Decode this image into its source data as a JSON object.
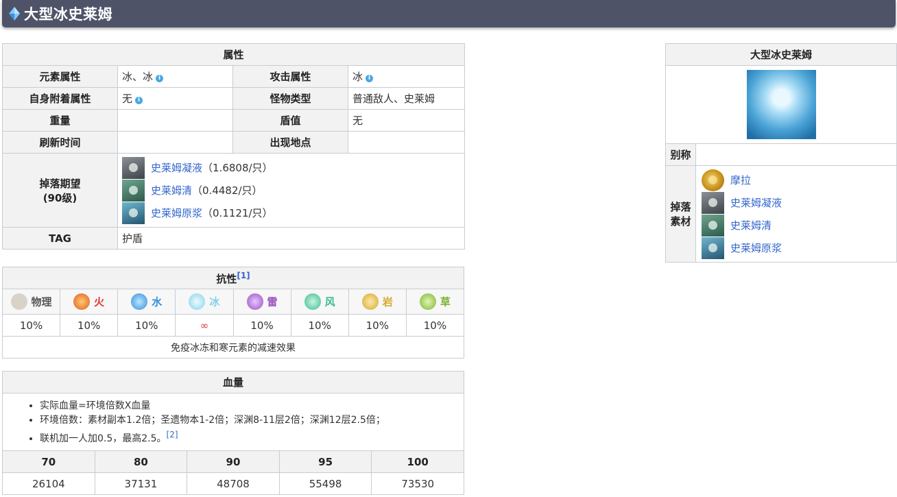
{
  "page": {
    "title": "大型冰史莱姆"
  },
  "attributes": {
    "header": "属性",
    "element_label": "元素属性",
    "element_value": "冰、冰",
    "attack_label": "攻击属性",
    "attack_value": "冰",
    "self_label": "自身附着属性",
    "self_value": "无",
    "type_label": "怪物类型",
    "type_value": "普通敌人、史莱姆",
    "weight_label": "重量",
    "weight_value": "",
    "shield_label": "盾值",
    "shield_value": "无",
    "refresh_label": "刷新时间",
    "refresh_value": "",
    "location_label": "出现地点",
    "location_value": "",
    "drop_label": "掉落期望",
    "drop_label2": "(90级)",
    "drops": [
      {
        "name": "史莱姆凝液",
        "rate": "（1.6808/只）",
        "icon": "slime-condensate-icon"
      },
      {
        "name": "史莱姆清",
        "rate": "（0.4482/只）",
        "icon": "slime-secretions-icon"
      },
      {
        "name": "史莱姆原浆",
        "rate": "（0.1121/只）",
        "icon": "slime-concentrate-icon"
      }
    ],
    "tag_label": "TAG",
    "tag_value": "护盾"
  },
  "resistance": {
    "header": "抗性",
    "ref": "[1]",
    "columns": [
      {
        "label": "物理",
        "value": "10%",
        "color": "#555555"
      },
      {
        "label": "火",
        "value": "10%",
        "color": "#e0332b"
      },
      {
        "label": "水",
        "value": "10%",
        "color": "#2e8fd8"
      },
      {
        "label": "冰",
        "value": "∞",
        "color": "#7fd3ec"
      },
      {
        "label": "雷",
        "value": "10%",
        "color": "#9a4fc0"
      },
      {
        "label": "风",
        "value": "10%",
        "color": "#3dbb8f"
      },
      {
        "label": "岩",
        "value": "10%",
        "color": "#d7a82d"
      },
      {
        "label": "草",
        "value": "10%",
        "color": "#7bb52e"
      }
    ],
    "note": "免疫冰冻和寒元素的减速效果"
  },
  "hp": {
    "header": "血量",
    "notes": [
      "实际血量=环境倍数X血量",
      "环境倍数：素材副本1.2倍；圣遗物本1-2倍；深渊8-11层2倍；深渊12层2.5倍；",
      "联机加一人加0.5，最高2.5。"
    ],
    "note_ref": "[2]",
    "levels": [
      "70",
      "80",
      "90",
      "95",
      "100"
    ],
    "values": [
      "26104",
      "37131",
      "48708",
      "55498",
      "73530"
    ]
  },
  "sidebar": {
    "title": "大型冰史莱姆",
    "alias_label": "别称",
    "alias_value": "",
    "drop_label": "掉落素材",
    "materials": [
      {
        "name": "摩拉",
        "icon": "mora-icon"
      },
      {
        "name": "史莱姆凝液",
        "icon": "slime-condensate-icon"
      },
      {
        "name": "史莱姆清",
        "icon": "slime-secretions-icon"
      },
      {
        "name": "史莱姆原浆",
        "icon": "slime-concentrate-icon"
      }
    ]
  }
}
